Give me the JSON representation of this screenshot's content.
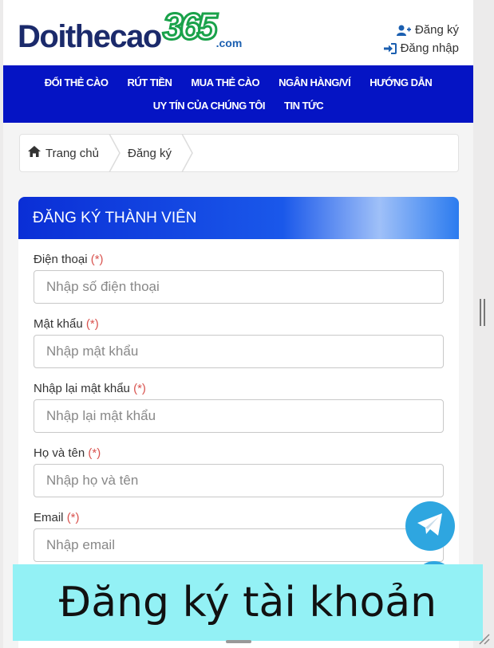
{
  "logo": {
    "main": "Doithecao",
    "num": "365",
    "suffix": ".com"
  },
  "auth": {
    "register": "Đăng ký",
    "login": "Đăng nhập"
  },
  "nav": {
    "row1": [
      "ĐỔI THẺ CÀO",
      "RÚT TIỀN",
      "MUA THẺ CÀO",
      "NGÂN HÀNG/VÍ",
      "HƯỚNG DẪN"
    ],
    "row2": [
      "UY TÍN CỦA CHÚNG TÔI",
      "TIN TỨC"
    ]
  },
  "breadcrumb": {
    "home": "Trang chủ",
    "current": "Đăng ký"
  },
  "form": {
    "title": "ĐĂNG KÝ THÀNH VIÊN",
    "required_mark": "(*)",
    "fields": [
      {
        "label": "Điện thoại",
        "placeholder": "Nhập số điện thoại"
      },
      {
        "label": "Mật khẩu",
        "placeholder": "Nhập mật khẩu"
      },
      {
        "label": "Nhập lại mật khẩu",
        "placeholder": "Nhập lại mật khẩu"
      },
      {
        "label": "Họ và tên",
        "placeholder": "Nhập họ và tên"
      },
      {
        "label": "Email",
        "placeholder": "Nhập email"
      }
    ]
  },
  "caption": "Đăng ký tài khoản",
  "colors": {
    "nav_bg": "#0514c4",
    "header_gradient_start": "#0a2ed6",
    "required": "#d9534f",
    "caption_bg": "#93f1f5",
    "telegram": "#2ea6e0"
  },
  "icons": [
    "user-plus-icon",
    "sign-in-icon",
    "home-icon",
    "telegram-icon"
  ]
}
